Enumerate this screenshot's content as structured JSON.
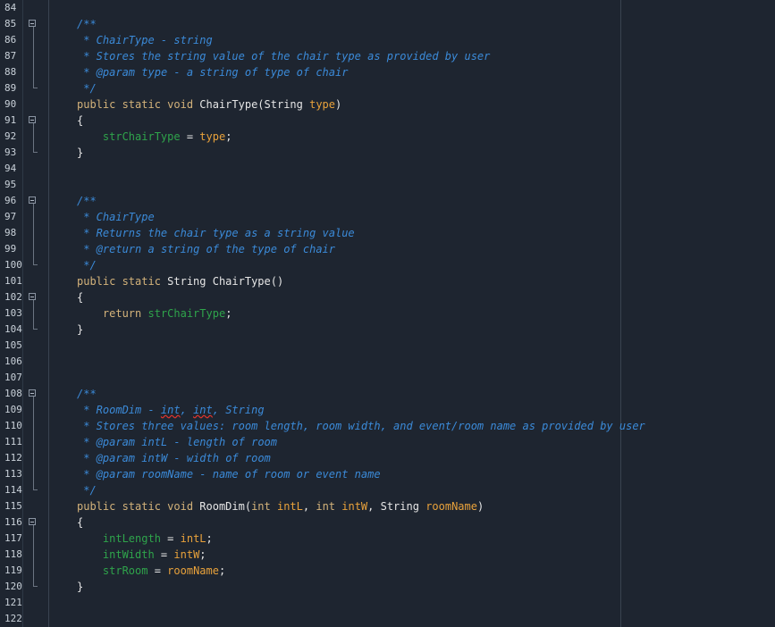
{
  "editor": {
    "lines": [
      {
        "n": "84",
        "fold": false,
        "segs": []
      },
      {
        "n": "85",
        "fold": true,
        "segs": [
          {
            "c": "c",
            "t": "/**"
          }
        ]
      },
      {
        "n": "86",
        "fold": false,
        "segs": [
          {
            "c": "c",
            "t": " * ChairType - string"
          }
        ]
      },
      {
        "n": "87",
        "fold": false,
        "segs": [
          {
            "c": "c",
            "t": " * Stores the string value of the chair type as provided by user"
          }
        ]
      },
      {
        "n": "88",
        "fold": false,
        "segs": [
          {
            "c": "c",
            "t": " * "
          },
          {
            "c": "c b",
            "t": "@param"
          },
          {
            "c": "c",
            "t": " type - a string of type of chair"
          }
        ]
      },
      {
        "n": "89",
        "fold": false,
        "segs": [
          {
            "c": "c",
            "t": " */"
          }
        ]
      },
      {
        "n": "90",
        "fold": false,
        "segs": [
          {
            "c": "kw",
            "t": "public static void "
          },
          {
            "c": "id",
            "t": "ChairType(String "
          },
          {
            "c": "par",
            "t": "type"
          },
          {
            "c": "id",
            "t": ")"
          }
        ]
      },
      {
        "n": "91",
        "fold": true,
        "segs": [
          {
            "c": "p",
            "t": "{"
          }
        ]
      },
      {
        "n": "92",
        "fold": false,
        "segs": [
          {
            "c": "p",
            "t": "    "
          },
          {
            "c": "fld",
            "t": "strChairType"
          },
          {
            "c": "p",
            "t": " = "
          },
          {
            "c": "par",
            "t": "type"
          },
          {
            "c": "p",
            "t": ";"
          }
        ]
      },
      {
        "n": "93",
        "fold": false,
        "segs": [
          {
            "c": "p",
            "t": "}"
          }
        ]
      },
      {
        "n": "94",
        "fold": false,
        "segs": []
      },
      {
        "n": "95",
        "fold": false,
        "segs": []
      },
      {
        "n": "96",
        "fold": true,
        "segs": [
          {
            "c": "c",
            "t": "/**"
          }
        ]
      },
      {
        "n": "97",
        "fold": false,
        "segs": [
          {
            "c": "c",
            "t": " * ChairType"
          }
        ]
      },
      {
        "n": "98",
        "fold": false,
        "segs": [
          {
            "c": "c",
            "t": " * Returns the chair type as a string value"
          }
        ]
      },
      {
        "n": "99",
        "fold": false,
        "segs": [
          {
            "c": "c",
            "t": " * "
          },
          {
            "c": "c b",
            "t": "@return"
          },
          {
            "c": "c",
            "t": " a string of the type of chair"
          }
        ]
      },
      {
        "n": "100",
        "fold": false,
        "segs": [
          {
            "c": "c",
            "t": " */"
          }
        ]
      },
      {
        "n": "101",
        "fold": false,
        "segs": [
          {
            "c": "kw",
            "t": "public static "
          },
          {
            "c": "id",
            "t": "String ChairType()"
          }
        ]
      },
      {
        "n": "102",
        "fold": true,
        "segs": [
          {
            "c": "p",
            "t": "{"
          }
        ]
      },
      {
        "n": "103",
        "fold": false,
        "segs": [
          {
            "c": "p",
            "t": "    "
          },
          {
            "c": "kw",
            "t": "return "
          },
          {
            "c": "fld",
            "t": "strChairType"
          },
          {
            "c": "p",
            "t": ";"
          }
        ]
      },
      {
        "n": "104",
        "fold": false,
        "segs": [
          {
            "c": "p",
            "t": "}"
          }
        ]
      },
      {
        "n": "105",
        "fold": false,
        "segs": []
      },
      {
        "n": "106",
        "fold": false,
        "segs": []
      },
      {
        "n": "107",
        "fold": false,
        "segs": []
      },
      {
        "n": "108",
        "fold": true,
        "segs": [
          {
            "c": "c",
            "t": "/**"
          }
        ]
      },
      {
        "n": "109",
        "fold": false,
        "segs": [
          {
            "c": "c",
            "t": " * RoomDim - "
          },
          {
            "c": "c sq",
            "t": "int"
          },
          {
            "c": "c",
            "t": ", "
          },
          {
            "c": "c sq",
            "t": "int"
          },
          {
            "c": "c",
            "t": ", String"
          }
        ]
      },
      {
        "n": "110",
        "fold": false,
        "segs": [
          {
            "c": "c",
            "t": " * Stores three values: room length, room width, and event/room name as provided by user"
          }
        ]
      },
      {
        "n": "111",
        "fold": false,
        "segs": [
          {
            "c": "c",
            "t": " * "
          },
          {
            "c": "c b",
            "t": "@param"
          },
          {
            "c": "c",
            "t": " intL - length of room"
          }
        ]
      },
      {
        "n": "112",
        "fold": false,
        "segs": [
          {
            "c": "c",
            "t": " * "
          },
          {
            "c": "c b",
            "t": "@param"
          },
          {
            "c": "c",
            "t": " intW - width of room"
          }
        ]
      },
      {
        "n": "113",
        "fold": false,
        "segs": [
          {
            "c": "c",
            "t": " * "
          },
          {
            "c": "c b",
            "t": "@param"
          },
          {
            "c": "c",
            "t": " roomName - name of room or event name"
          }
        ]
      },
      {
        "n": "114",
        "fold": false,
        "segs": [
          {
            "c": "c",
            "t": " */"
          }
        ]
      },
      {
        "n": "115",
        "fold": false,
        "segs": [
          {
            "c": "kw",
            "t": "public static void "
          },
          {
            "c": "id",
            "t": "RoomDim("
          },
          {
            "c": "kw",
            "t": "int "
          },
          {
            "c": "par",
            "t": "intL"
          },
          {
            "c": "id",
            "t": ", "
          },
          {
            "c": "kw",
            "t": "int "
          },
          {
            "c": "par",
            "t": "intW"
          },
          {
            "c": "id",
            "t": ", String "
          },
          {
            "c": "par",
            "t": "roomName"
          },
          {
            "c": "id",
            "t": ")"
          }
        ]
      },
      {
        "n": "116",
        "fold": true,
        "segs": [
          {
            "c": "p",
            "t": "{"
          }
        ]
      },
      {
        "n": "117",
        "fold": false,
        "segs": [
          {
            "c": "p",
            "t": "    "
          },
          {
            "c": "fld",
            "t": "intLength"
          },
          {
            "c": "p",
            "t": " = "
          },
          {
            "c": "par",
            "t": "intL"
          },
          {
            "c": "p",
            "t": ";"
          }
        ]
      },
      {
        "n": "118",
        "fold": false,
        "segs": [
          {
            "c": "p",
            "t": "    "
          },
          {
            "c": "fld",
            "t": "intWidth"
          },
          {
            "c": "p",
            "t": " = "
          },
          {
            "c": "par",
            "t": "intW"
          },
          {
            "c": "p",
            "t": ";"
          }
        ]
      },
      {
        "n": "119",
        "fold": false,
        "segs": [
          {
            "c": "p",
            "t": "    "
          },
          {
            "c": "fld",
            "t": "strRoom"
          },
          {
            "c": "p",
            "t": " = "
          },
          {
            "c": "par",
            "t": "roomName"
          },
          {
            "c": "p",
            "t": ";"
          }
        ]
      },
      {
        "n": "120",
        "fold": false,
        "segs": [
          {
            "c": "p",
            "t": "}"
          }
        ]
      },
      {
        "n": "121",
        "fold": false,
        "segs": []
      },
      {
        "n": "122",
        "fold": false,
        "segs": []
      }
    ]
  },
  "colors": {
    "background": "#1e2530",
    "comment": "#3b8ad8",
    "keyword": "#d3b27a",
    "parameter": "#e9a23b",
    "field": "#2fa44b",
    "plain": "#e6e6e6",
    "squiggle": "#e0342d"
  },
  "icons": {
    "fold": "fold-minus-icon"
  }
}
